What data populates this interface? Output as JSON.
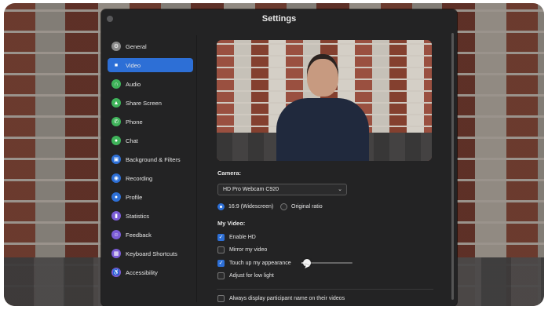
{
  "window": {
    "title": "Settings"
  },
  "sidebar": {
    "items": [
      {
        "label": "General",
        "icon": "gear-icon",
        "color": "#8a8a8a",
        "glyph": "⚙"
      },
      {
        "label": "Video",
        "icon": "video-camera-icon",
        "color": "#2d6fd6",
        "glyph": "■",
        "active": true
      },
      {
        "label": "Audio",
        "icon": "headphones-icon",
        "color": "#3fb35a",
        "glyph": "∩"
      },
      {
        "label": "Share Screen",
        "icon": "share-screen-icon",
        "color": "#3fb35a",
        "glyph": "▲"
      },
      {
        "label": "Phone",
        "icon": "phone-icon",
        "color": "#3fb35a",
        "glyph": "✆"
      },
      {
        "label": "Chat",
        "icon": "chat-icon",
        "color": "#3fb35a",
        "glyph": "●"
      },
      {
        "label": "Background & Filters",
        "icon": "background-filters-icon",
        "color": "#2d6fd6",
        "glyph": "▣"
      },
      {
        "label": "Recording",
        "icon": "recording-icon",
        "color": "#2d6fd6",
        "glyph": "◉"
      },
      {
        "label": "Profile",
        "icon": "profile-icon",
        "color": "#2d6fd6",
        "glyph": "●"
      },
      {
        "label": "Statistics",
        "icon": "statistics-icon",
        "color": "#7b5cd6",
        "glyph": "▮"
      },
      {
        "label": "Feedback",
        "icon": "feedback-icon",
        "color": "#7b5cd6",
        "glyph": "☺"
      },
      {
        "label": "Keyboard Shortcuts",
        "icon": "keyboard-icon",
        "color": "#7b5cd6",
        "glyph": "▦"
      },
      {
        "label": "Accessibility",
        "icon": "accessibility-icon",
        "color": "#7b5cd6",
        "glyph": "♿"
      }
    ]
  },
  "video": {
    "camera_label": "Camera:",
    "camera_value": "HD Pro Webcam C920",
    "ratio_options": [
      "16:9 (Widescreen)",
      "Original ratio"
    ],
    "ratio_selected": "16:9 (Widescreen)",
    "my_video_label": "My Video:",
    "options": [
      {
        "label": "Enable HD",
        "checked": true
      },
      {
        "label": "Mirror my video",
        "checked": false
      },
      {
        "label": "Touch up my appearance",
        "checked": true
      },
      {
        "label": "Adjust for low light",
        "checked": false
      }
    ],
    "touch_up_level": 0.1,
    "display_names_label": "Always display participant name on their videos",
    "display_names_checked": false
  },
  "colors": {
    "accent": "#2d6fd6",
    "window_bg": "#232324"
  }
}
